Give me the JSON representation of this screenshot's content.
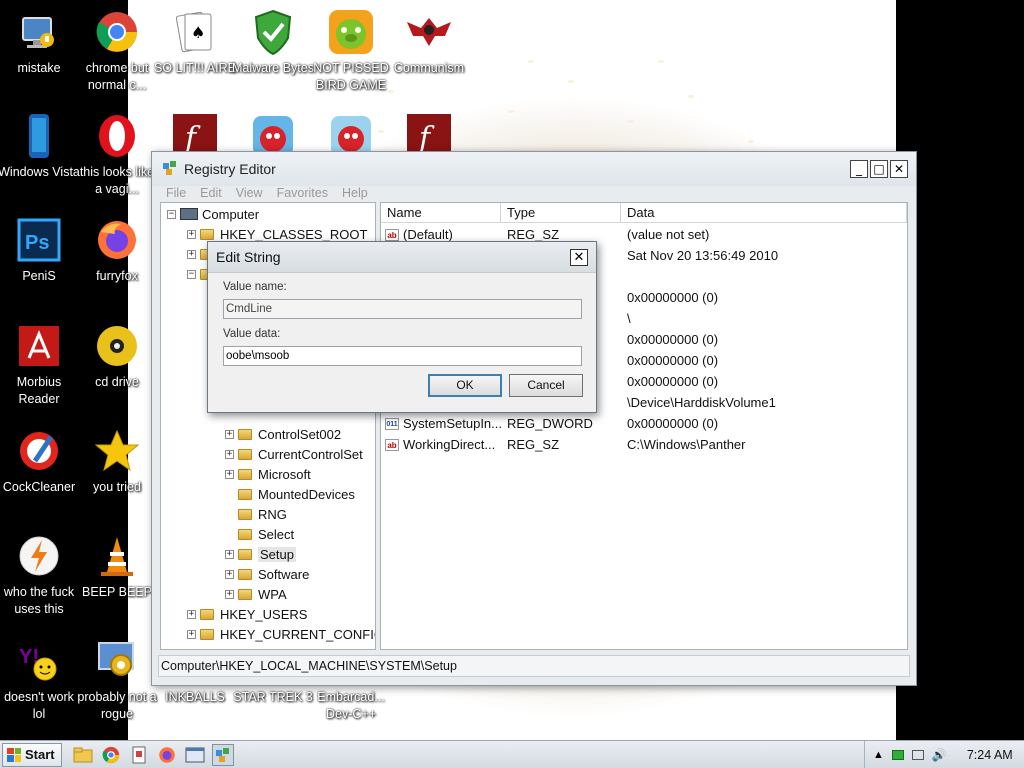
{
  "desktop": {
    "icons": [
      {
        "label": "mistake",
        "icon": "computer-monitor-icon"
      },
      {
        "label": "chrome but normal c...",
        "icon": "chrome-icon"
      },
      {
        "label": "SO LIT!!! AIRE",
        "icon": "solitaire-cards-icon"
      },
      {
        "label": "Malware Bytes",
        "icon": "shield-check-icon"
      },
      {
        "label": "NOT PISSED BIRD GAME",
        "icon": "green-pig-icon"
      },
      {
        "label": "Communism",
        "icon": "eagle-emblem-icon"
      },
      {
        "label": "Windows Vista",
        "icon": "phone-icon"
      },
      {
        "label": "this looks like a vagi...",
        "icon": "opera-icon"
      },
      {
        "label": "PeniS",
        "icon": "photoshop-icon"
      },
      {
        "label": "furryfox",
        "icon": "firefox-icon"
      },
      {
        "label": "Morbius Reader",
        "icon": "pdf-reader-icon"
      },
      {
        "label": "cd drive",
        "icon": "cd-icon"
      },
      {
        "label": "CockCleaner",
        "icon": "ccleaner-icon"
      },
      {
        "label": "you tried",
        "icon": "star-icon"
      },
      {
        "label": "who the fuck uses this",
        "icon": "lightning-icon"
      },
      {
        "label": "BEEP BEEP",
        "icon": "traffic-cone-icon"
      },
      {
        "label": "doesn't work lol",
        "icon": "yahoo-messenger-icon"
      },
      {
        "label": "probably not a rogue",
        "icon": "gear-monitor-icon"
      },
      {
        "label": "INKBALLS",
        "icon": ""
      },
      {
        "label": "STAR TREK 3",
        "icon": ""
      },
      {
        "label": "Embarcad... Dev-C++",
        "icon": ""
      }
    ],
    "colors": {
      "background": "#000000",
      "label_text": "#ffffff"
    }
  },
  "regedit": {
    "title": "Registry Editor",
    "menu": [
      "File",
      "Edit",
      "View",
      "Favorites",
      "Help"
    ],
    "window_buttons": {
      "minimize": "_",
      "maximize": "□",
      "close": "✕"
    },
    "tree": [
      {
        "label": "Computer",
        "expander": "−"
      },
      {
        "label": "HKEY_CLASSES_ROOT",
        "expander": "+"
      },
      {
        "label": "ControlSet002",
        "expander": "+"
      },
      {
        "label": "CurrentControlSet",
        "expander": "+"
      },
      {
        "label": "Microsoft",
        "expander": "+"
      },
      {
        "label": "MountedDevices",
        "expander": ""
      },
      {
        "label": "RNG",
        "expander": ""
      },
      {
        "label": "Select",
        "expander": ""
      },
      {
        "label": "Setup",
        "expander": "+"
      },
      {
        "label": "Software",
        "expander": "+"
      },
      {
        "label": "WPA",
        "expander": "+"
      },
      {
        "label": "HKEY_USERS",
        "expander": "+"
      },
      {
        "label": "HKEY_CURRENT_CONFIG",
        "expander": "+"
      }
    ],
    "columns": [
      "Name",
      "Type",
      "Data"
    ],
    "values": [
      {
        "name": "(Default)",
        "type": "REG_SZ",
        "data": "(value not set)",
        "kind": "ab"
      },
      {
        "name": "",
        "type": "",
        "data": "Sat Nov 20 13:56:49 2010",
        "kind": ""
      },
      {
        "name": "",
        "type": "",
        "data": "0x00000000 (0)",
        "kind": ""
      },
      {
        "name": "",
        "type": "",
        "data": "\\",
        "kind": ""
      },
      {
        "name": "",
        "type": "",
        "data": "0x00000000 (0)",
        "kind": ""
      },
      {
        "name": "",
        "type": "",
        "data": "0x00000000 (0)",
        "kind": ""
      },
      {
        "name": "",
        "type": "",
        "data": "0x00000000 (0)",
        "kind": ""
      },
      {
        "name": "",
        "type": "",
        "data": "\\Device\\HarddiskVolume1",
        "kind": ""
      },
      {
        "name": "SystemSetupIn...",
        "type": "REG_DWORD",
        "data": "0x00000000 (0)",
        "kind": "bin"
      },
      {
        "name": "WorkingDirect...",
        "type": "REG_SZ",
        "data": "C:\\Windows\\Panther",
        "kind": "ab"
      }
    ],
    "status": "Computer\\HKEY_LOCAL_MACHINE\\SYSTEM\\Setup"
  },
  "dialog": {
    "title": "Edit String",
    "close": "✕",
    "value_name_label": "Value name:",
    "value_name": "CmdLine",
    "value_data_label": "Value data:",
    "value_data": "oobe\\msoob",
    "ok": "OK",
    "cancel": "Cancel"
  },
  "taskbar": {
    "start_label": "Start",
    "quick_launch": [
      "folder-icon",
      "chrome-icon",
      "notepad-icon",
      "firefox-icon",
      "window-icon",
      "regedit-icon"
    ],
    "clock": "7:24 AM",
    "tray": [
      "chevron-up-icon",
      "network-icon",
      "monitor-icon",
      "speaker-icon"
    ]
  }
}
